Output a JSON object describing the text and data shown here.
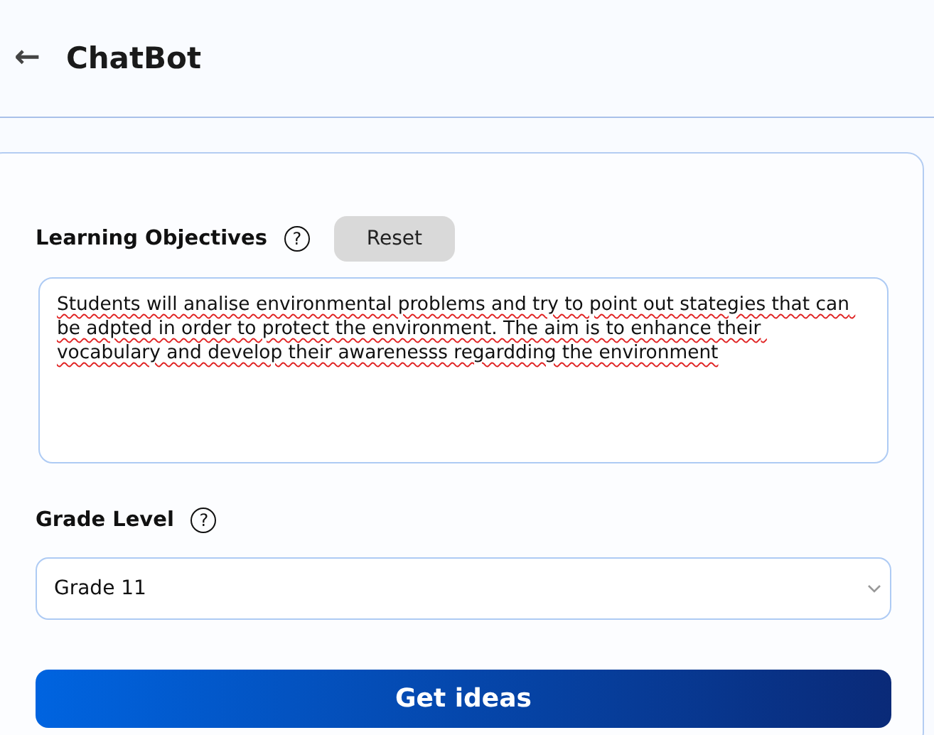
{
  "header": {
    "back_icon": "←",
    "title": "ChatBot"
  },
  "objectives": {
    "label": "Learning Objectives",
    "help": "?",
    "reset_button": "Reset",
    "value": "Students will analise environmental problems and try to point out stategies that can be adpted in order to protect the environment. The aim is to enhance their vocabulary and develop their awarenesss regardding the environment"
  },
  "grade": {
    "label": "Grade Level",
    "help": "?",
    "value": "Grade 11"
  },
  "submit_button": "Get ideas"
}
